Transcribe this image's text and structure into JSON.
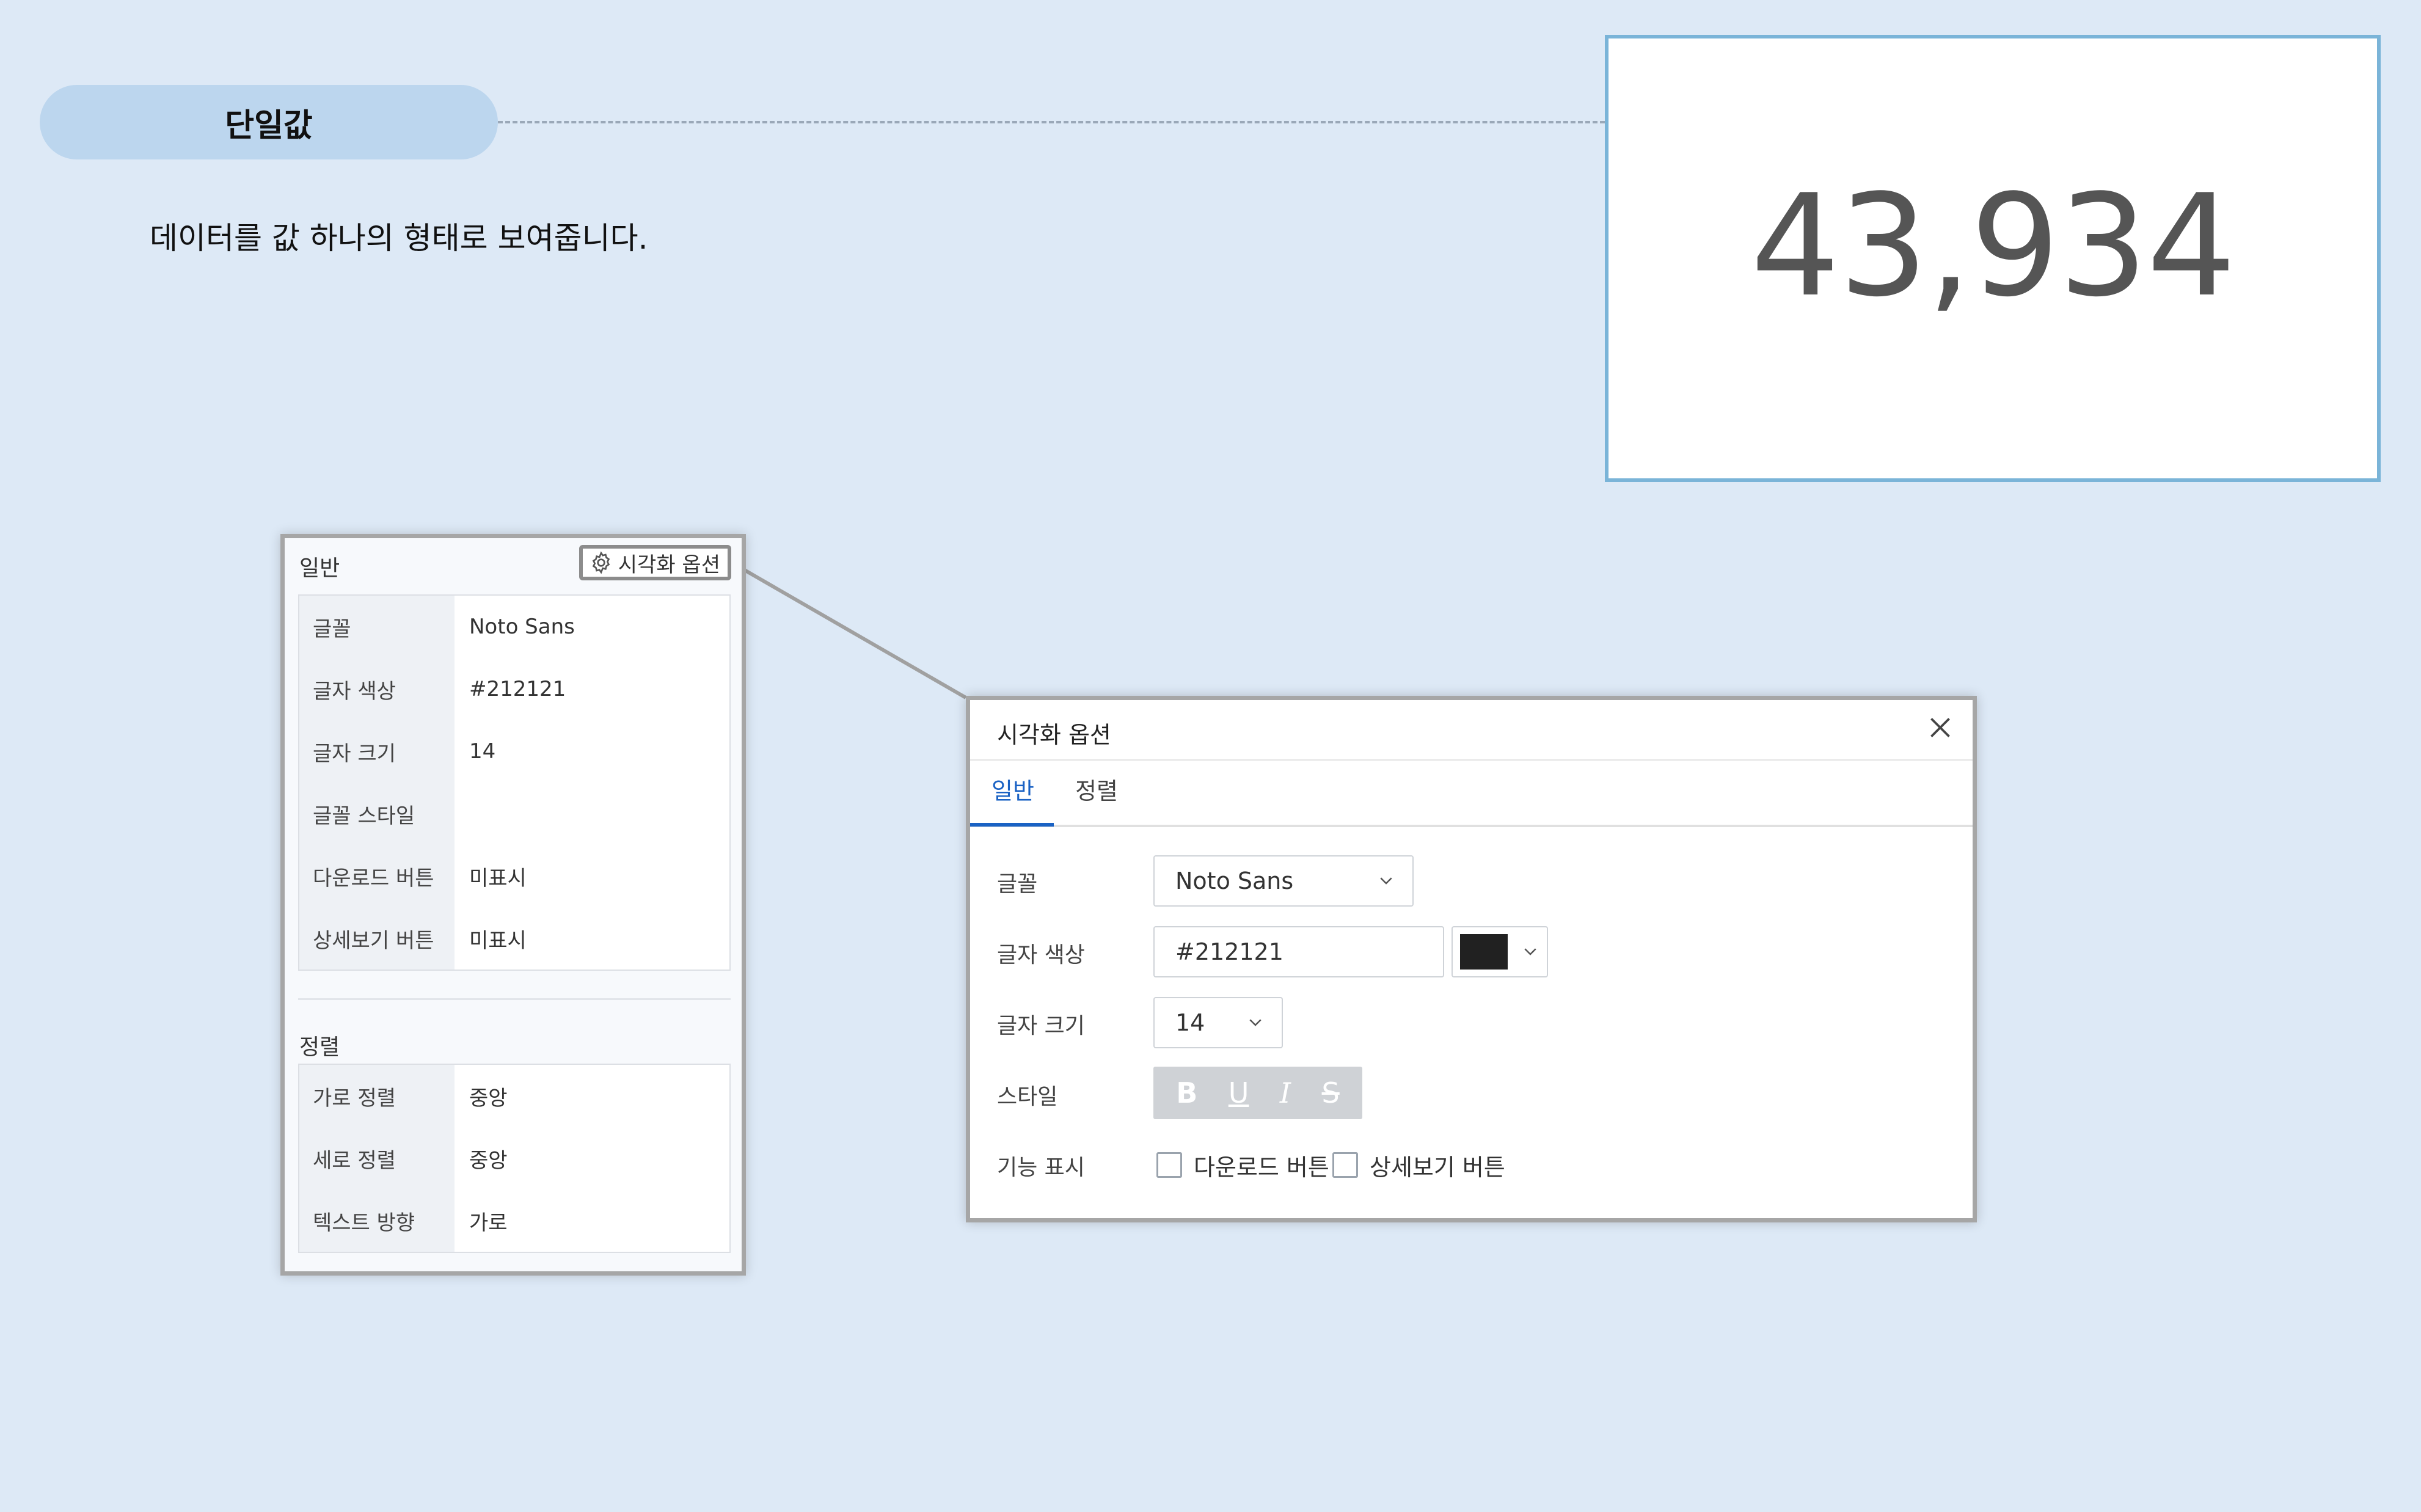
{
  "header": {
    "title": "단일값",
    "description": "데이터를 값 하나의 형태로 보여줍니다."
  },
  "value_card": {
    "value": "43,934"
  },
  "properties_panel": {
    "general_header": "일반",
    "options_button_label": "시각화 옵션",
    "general_rows": [
      {
        "key": "글꼴",
        "value": "Noto Sans"
      },
      {
        "key": "글자 색상",
        "value": "#212121"
      },
      {
        "key": "글자 크기",
        "value": "14"
      },
      {
        "key": "글꼴 스타일",
        "value": ""
      },
      {
        "key": "다운로드 버튼",
        "value": "미표시"
      },
      {
        "key": "상세보기 버튼",
        "value": "미표시"
      }
    ],
    "align_header": "정렬",
    "align_rows": [
      {
        "key": "가로 정렬",
        "value": "중앙"
      },
      {
        "key": "세로 정렬",
        "value": "중앙"
      },
      {
        "key": "텍스트 방향",
        "value": "가로"
      }
    ]
  },
  "dialog": {
    "title": "시각화 옵션",
    "tabs": [
      "일반",
      "정렬"
    ],
    "active_tab": "일반",
    "fields": {
      "font_label": "글꼴",
      "font_value": "Noto Sans",
      "color_label": "글자 색상",
      "color_value": "#212121",
      "size_label": "글자 크기",
      "size_value": "14",
      "style_label": "스타일",
      "style_buttons": [
        "B",
        "U",
        "I",
        "S"
      ],
      "features_label": "기능 표시",
      "download_checkbox_label": "다운로드 버튼",
      "detail_checkbox_label": "상세보기 버튼"
    }
  },
  "colors": {
    "background": "#dde9f6",
    "pill": "#bcd6ee",
    "card_border": "#7ab4d8",
    "accent": "#1a62c4",
    "swatch": "#212121"
  }
}
